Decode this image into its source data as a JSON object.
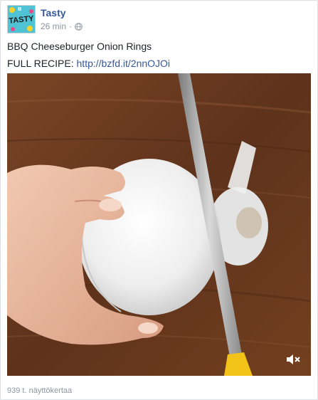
{
  "post": {
    "page_name": "Tasty",
    "avatar_text": "TASTY",
    "time": "26 min",
    "separator": "·",
    "privacy_icon": "globe-icon",
    "caption_title": "BBQ Cheeseburger Onion Rings",
    "recipe_label": "FULL RECIPE:",
    "recipe_link": "http://bzfd.it/2nnOJOi",
    "views": "939 t. näyttökertaa"
  },
  "video": {
    "mute_icon": "speaker-muted-icon",
    "muted": true
  },
  "colors": {
    "link": "#365899",
    "meta": "#90949c",
    "text": "#1d2129",
    "avatar_bg": "#4fc3d4",
    "knife_handle": "#f2c218",
    "board": "#6b3d22"
  }
}
